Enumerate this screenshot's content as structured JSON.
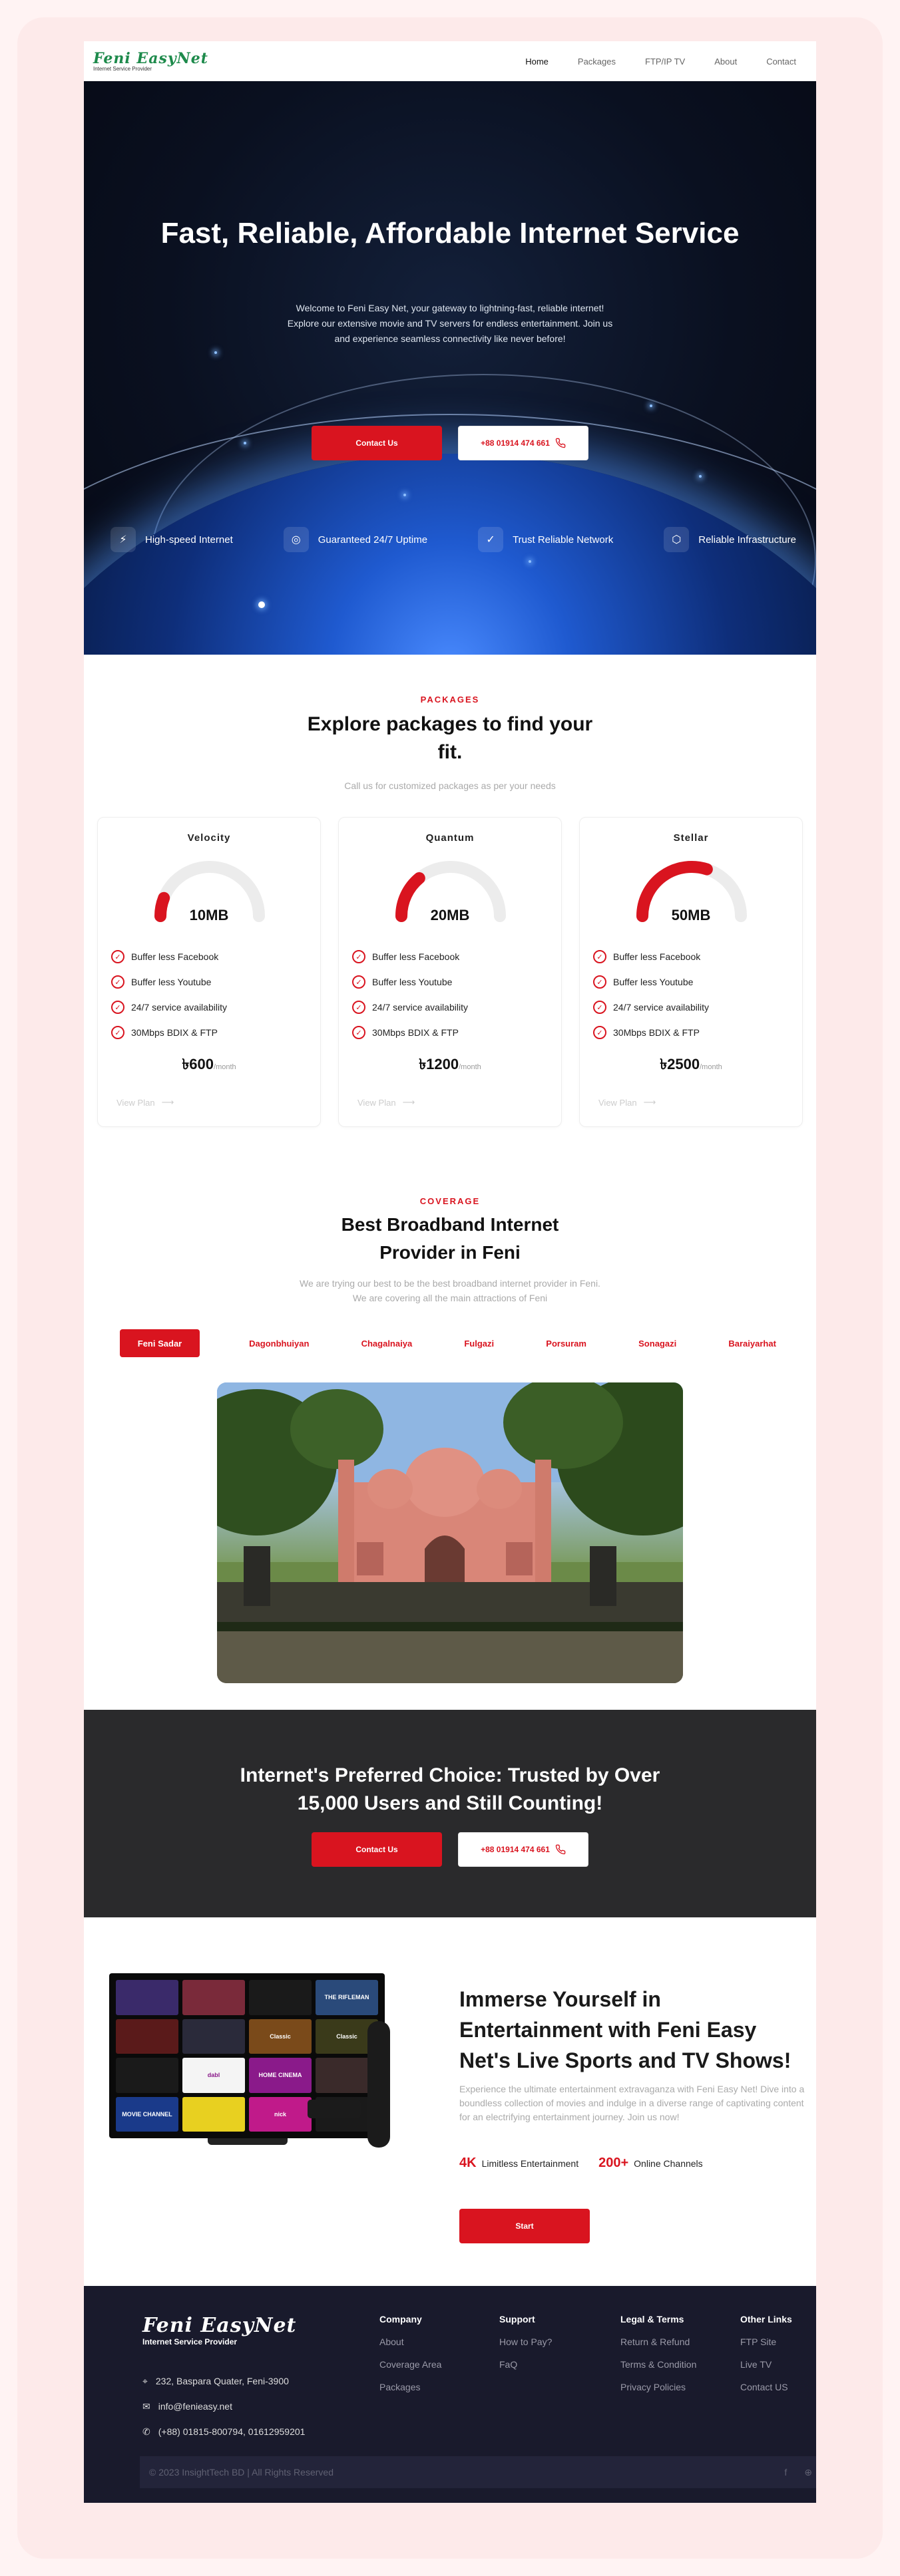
{
  "nav": {
    "logo_text": "Feni EasyNet",
    "logo_sub": "Internet Service Provider",
    "links": [
      "Home",
      "Packages",
      "FTP/IP TV",
      "About",
      "Contact"
    ],
    "active": "Home"
  },
  "hero": {
    "title": "Fast, Reliable, Affordable Internet Service",
    "lead": "Welcome to Feni Easy Net, your gateway to lightning-fast, reliable internet! Explore our extensive movie and TV servers for endless entertainment. Join us and experience seamless connectivity like never before!",
    "cta": "Contact Us",
    "phone": "+88 01914 474 661",
    "features": [
      "High-speed Internet",
      "Guaranteed 24/7 Uptime",
      "Trust Reliable Network",
      "Reliable Infrastructure"
    ]
  },
  "packages": {
    "eyebrow": "PACKAGES",
    "title": "Explore packages to find your fit.",
    "subtitle": "Call us for customized packages as per your needs",
    "cards": [
      {
        "name": "Velocity",
        "speed": "10MB",
        "level": 0.12,
        "features": [
          "Buffer less Facebook",
          "Buffer less Youtube",
          "24/7 service availability",
          "30Mbps BDIX & FTP"
        ],
        "price": "৳600",
        "per": "/month",
        "link": "View Plan"
      },
      {
        "name": "Quantum",
        "speed": "20MB",
        "level": 0.28,
        "features": [
          "Buffer less Facebook",
          "Buffer less Youtube",
          "24/7 service availability",
          "30Mbps BDIX & FTP"
        ],
        "price": "৳1200",
        "per": "/month",
        "link": "View Plan"
      },
      {
        "name": "Stellar",
        "speed": "50MB",
        "level": 0.6,
        "features": [
          "Buffer less Facebook",
          "Buffer less Youtube",
          "24/7 service availability",
          "30Mbps BDIX & FTP"
        ],
        "price": "৳2500",
        "per": "/month",
        "link": "View Plan"
      }
    ]
  },
  "coverage": {
    "eyebrow": "COVERAGE",
    "title": "Best Broadband Internet Provider in Feni",
    "subtitle_1": "We are trying our best to be the best broadband internet provider in Feni.",
    "subtitle_2": "We are covering all the main attractions of Feni",
    "tabs": [
      "Feni Sadar",
      "Dagonbhuiyan",
      "Chagalnaiya",
      "Fulgazi",
      "Porsuram",
      "Sonagazi",
      "Baraiyarhat"
    ],
    "active": "Feni Sadar"
  },
  "trust": {
    "title": "Internet's Preferred Choice: Trusted by Over 15,000 Users and Still Counting!",
    "cta": "Contact Us",
    "phone": "+88 01914 474 661"
  },
  "tv": {
    "title": "Immerse Yourself in Entertainment with Feni Easy Net's Live Sports and TV Shows!",
    "desc": "Experience the ultimate entertainment extravaganza with Feni Easy Net! Dive into a boundless collection of movies and indulge in a diverse range of captivating content for an electrifying entertainment journey. Join us now!",
    "stat1_value": "4K",
    "stat1_label": "Limitless Entertainment",
    "stat2_value": "200+",
    "stat2_label": "Online Channels",
    "cta": "Start",
    "tiles": [
      {
        "label": "",
        "color": "#3a2a6a"
      },
      {
        "label": "",
        "color": "#7a2a3a"
      },
      {
        "label": "",
        "color": "#1a1a1a"
      },
      {
        "label": "THE RIFLEMAN",
        "color": "#2a4a7a"
      },
      {
        "label": "",
        "color": "#5a1a1a"
      },
      {
        "label": "",
        "color": "#2a2a3a"
      },
      {
        "label": "Classic",
        "color": "#7a4a1a"
      },
      {
        "label": "Classic",
        "color": "#3a3a1a"
      },
      {
        "label": "",
        "color": "#1a1a1a"
      },
      {
        "label": "dabl",
        "color": "#f4f4f4"
      },
      {
        "label": "HOME CINEMA",
        "color": "#8a1a8a"
      },
      {
        "label": "",
        "color": "#3a2a2a"
      },
      {
        "label": "MOVIE CHANNEL",
        "color": "#1a3a8a"
      },
      {
        "label": "",
        "color": "#e8d020"
      },
      {
        "label": "nick",
        "color": "#c01a8a"
      },
      {
        "label": "",
        "color": "#1a1a1a"
      }
    ]
  },
  "footer": {
    "logo_text": "Feni EasyNet",
    "logo_sub": "Internet Service Provider",
    "address": "232, Baspara Quater, Feni-3900",
    "email": "info@feniеasy.net",
    "phones": "(+88) 01815-800794, 01612959201",
    "columns": [
      {
        "title": "Company",
        "links": [
          "About",
          "Coverage Area",
          "Packages"
        ]
      },
      {
        "title": "Support",
        "links": [
          "How to Pay?",
          "FaQ"
        ]
      },
      {
        "title": "Legal & Terms",
        "links": [
          "Return & Refund",
          "Terms & Condition",
          "Privacy Policies"
        ]
      },
      {
        "title": "Other Links",
        "links": [
          "FTP Site",
          "Live TV",
          "Contact US"
        ]
      }
    ],
    "copyright": "© 2023 InsightTech BD | All Rights Reserved"
  },
  "colors": {
    "brand_red": "#d9141f",
    "footer_bg": "#191a2c",
    "band_bg": "#2a2a2c",
    "logo_green": "#1d8a4b"
  }
}
